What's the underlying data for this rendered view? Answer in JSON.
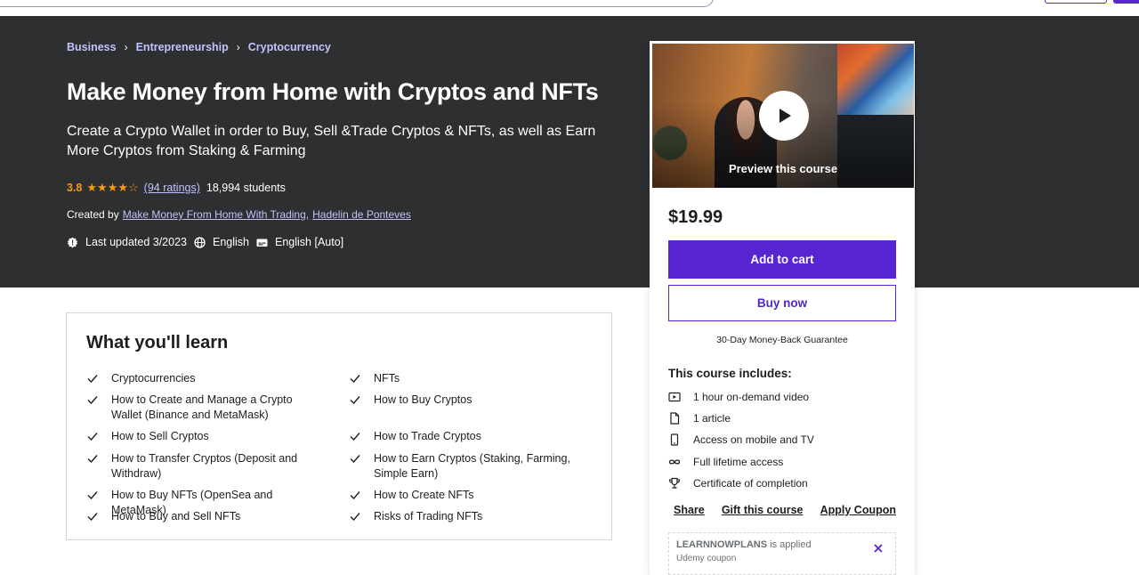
{
  "breadcrumb": [
    "Business",
    "Entrepreneurship",
    "Cryptocurrency"
  ],
  "course": {
    "title": "Make Money from Home with Cryptos and NFTs",
    "subtitle": "Create a Crypto Wallet in order to Buy, Sell &Trade Cryptos & NFTs, as well as Earn More Cryptos from Staking & Farming",
    "rating": "3.8",
    "ratings_link": "(94 ratings)",
    "students": "18,994 students",
    "created_by_label": "Created by",
    "instructors": [
      "Make Money From Home With Trading,",
      "Hadelin de Ponteves"
    ],
    "last_updated": "Last updated 3/2023",
    "language": "English",
    "captions": "English [Auto]"
  },
  "learn": {
    "title": "What you'll learn",
    "left": [
      "Cryptocurrencies",
      "How to Create and Manage a Crypto Wallet (Binance and MetaMask)",
      "How to Sell Cryptos",
      "How to Transfer Cryptos (Deposit and Withdraw)",
      "How to Buy NFTs (OpenSea and MetaMask)",
      "How to Buy and Sell NFTs"
    ],
    "right": [
      "NFTs",
      "How to Buy Cryptos",
      "How to Trade Cryptos",
      "How to Earn Cryptos (Staking, Farming, Simple Earn)",
      "How to Create NFTs",
      "Risks of Trading NFTs"
    ]
  },
  "sidebar": {
    "preview_label": "Preview this course",
    "price": "$19.99",
    "add_to_cart": "Add to cart",
    "buy_now": "Buy now",
    "guarantee": "30-Day Money-Back Guarantee",
    "includes_title": "This course includes:",
    "includes": [
      {
        "icon": "video-icon",
        "text": "1 hour on-demand video"
      },
      {
        "icon": "file-icon",
        "text": "1 article"
      },
      {
        "icon": "mobile-icon",
        "text": "Access on mobile and TV"
      },
      {
        "icon": "infinity-icon",
        "text": "Full lifetime access"
      },
      {
        "icon": "trophy-icon",
        "text": "Certificate of completion"
      }
    ],
    "links": [
      "Share",
      "Gift this course",
      "Apply Coupon"
    ],
    "coupon": {
      "code": "LEARNNOWPLANS",
      "applied": "is applied",
      "sub": "Udemy coupon"
    }
  },
  "colors": {
    "accent": "#5624d0",
    "hero_bg": "#2d2f31",
    "link_light": "#c0c4fc",
    "star": "#f69c08"
  }
}
